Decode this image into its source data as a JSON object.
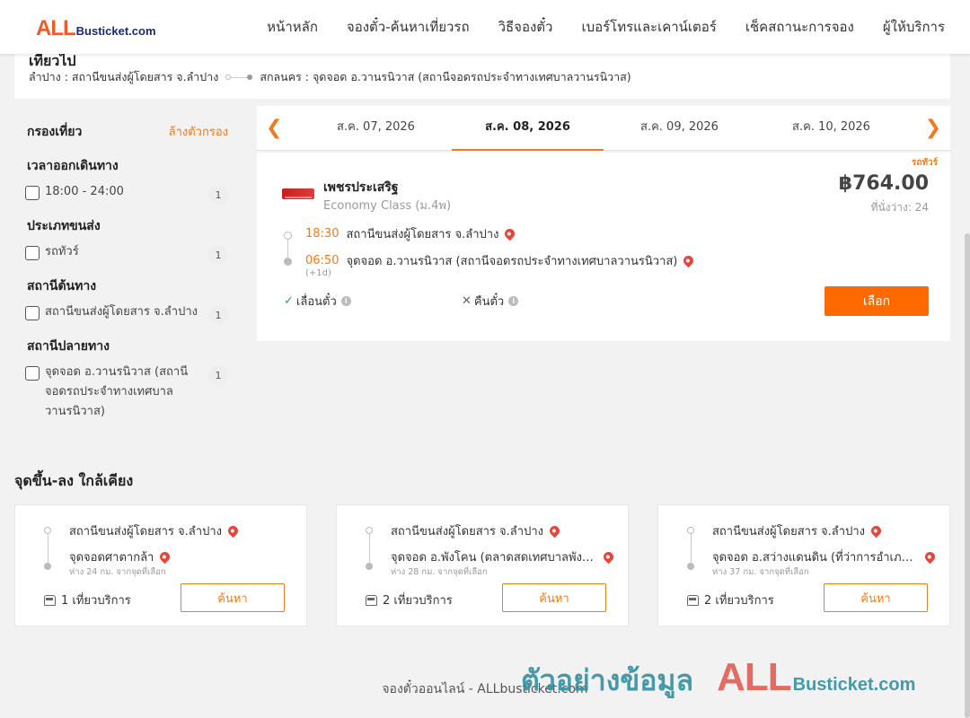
{
  "header": {
    "logo_big": "ALL",
    "logo_small": "Busticket.com",
    "nav": [
      "หน้าหลัก",
      "จองตั๋ว-ค้นหาเที่ยวรถ",
      "วิธีจองตั๋ว",
      "เบอร์โทรและเคาน์เตอร์",
      "เช็คสถานะการจอง",
      "ผู้ให้บริการ"
    ]
  },
  "route": {
    "title": "เที่ยวไป",
    "from": "ลำปาง : สถานีขนส่งผู้โดยสาร จ.ลำปาง",
    "to": "สกลนคร : จุดจอด อ.วานรนิวาส (สถานีจอดรถประจำทางเทศบาลวานรนิวาส)"
  },
  "filters": {
    "title": "กรองเที่ยว",
    "clear": "ล้างตัวกรอง",
    "groups": [
      {
        "title": "เวลาออกเดินทาง",
        "options": [
          {
            "label": "18:00 - 24:00",
            "count": "1"
          }
        ]
      },
      {
        "title": "ประเภทขนส่ง",
        "options": [
          {
            "label": "รถทัวร์",
            "count": "1"
          }
        ]
      },
      {
        "title": "สถานีต้นทาง",
        "options": [
          {
            "label": "สถานีขนส่งผู้โดยสาร จ.ลำปาง",
            "count": "1"
          }
        ]
      },
      {
        "title": "สถานีปลายทาง",
        "options": [
          {
            "label": "จุดจอด อ.วานรนิวาส (สถานีจอดรถประจำทางเทศบาลวานรนิวาส)",
            "count": "1"
          }
        ]
      }
    ]
  },
  "dates": {
    "tabs": [
      "ส.ค. 07, 2026",
      "ส.ค. 08, 2026",
      "ส.ค. 09, 2026",
      "ส.ค. 10, 2026"
    ],
    "active_index": 1
  },
  "result": {
    "badge": "รถทัวร์",
    "operator": "เพชรประเสริฐ",
    "class": "Economy Class (ม.4พ)",
    "price": "฿764.00",
    "seats": "ที่นั่งว่าง: 24",
    "depart_time": "18:30",
    "depart_station": "สถานีขนส่งผู้โดยสาร จ.ลำปาง",
    "arrive_time": "06:50",
    "arrive_station": "จุดจอด อ.วานรนิวาส (สถานีจอดรถประจำทางเทศบาลวานรนิวาส)",
    "plus_day": "(+1d)",
    "reschedule": "เลื่อนตั๋ว",
    "refund": "คืนตั๋ว",
    "select": "เลือก"
  },
  "nearby": {
    "title": "จุดขึ้น-ลง ใกล้เคียง",
    "cards": [
      {
        "from": "สถานีขนส่งผู้โดยสาร จ.ลำปาง",
        "to": "จุดจอดศาตากล้า",
        "dist": "ห่าง 24 กม. จากจุดที่เลือก",
        "trips": "1 เที่ยวบริการ",
        "btn": "ค้นหา"
      },
      {
        "from": "สถานีขนส่งผู้โดยสาร จ.ลำปาง",
        "to": "จุดจอด อ.พังโคน (ตลาดสดเทศบาลพังโคน)",
        "dist": "ห่าง 28 กม. จากจุดที่เลือก",
        "trips": "2 เที่ยวบริการ",
        "btn": "ค้นหา"
      },
      {
        "from": "สถานีขนส่งผู้โดยสาร จ.ลำปาง",
        "to": "จุดจอด อ.สว่างแดนดิน (ที่ว่าการอำเภอสว่างแดนดิน)",
        "dist": "ห่าง 37 กม. จากจุดที่เลือก",
        "trips": "2 เที่ยวบริการ",
        "btn": "ค้นหา"
      }
    ]
  },
  "footer": "จองตั๋วออนไลน์ - ALLbusticket.com",
  "watermark": {
    "thai": "ตัวอย่างข้อมูล",
    "big": "ALL",
    "small": "Busticket.com"
  },
  "colors": {
    "accent": "#f07a1e",
    "button": "#ff6a00",
    "pin": "#e8443a",
    "check": "#2ea44f"
  }
}
